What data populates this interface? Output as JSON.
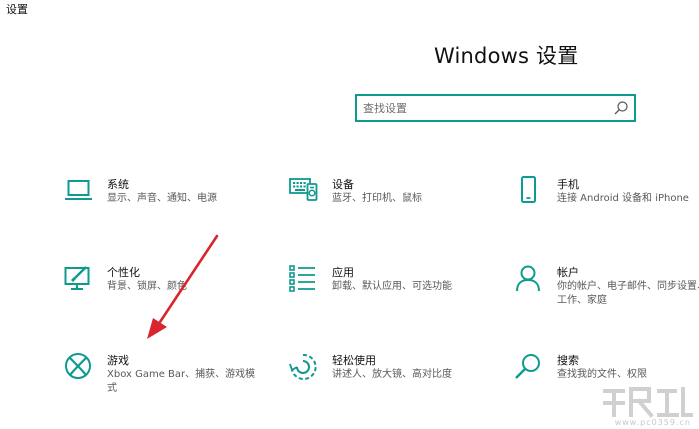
{
  "window": {
    "title": "设置"
  },
  "header": {
    "title": "Windows 设置"
  },
  "search": {
    "placeholder": "查找设置",
    "value": ""
  },
  "tiles": [
    {
      "name": "系统",
      "desc": "显示、声音、通知、电源",
      "icon": "laptop-icon"
    },
    {
      "name": "设备",
      "desc": "蓝牙、打印机、鼠标",
      "icon": "keyboard-icon"
    },
    {
      "name": "手机",
      "desc": "连接 Android 设备和 iPhone",
      "icon": "phone-icon"
    },
    {
      "name": "个性化",
      "desc": "背景、锁屏、颜色",
      "icon": "brush-icon"
    },
    {
      "name": "应用",
      "desc": "卸载、默认应用、可选功能",
      "icon": "apps-list-icon"
    },
    {
      "name": "帐户",
      "desc": "你的帐户、电子邮件、同步设置、工作、家庭",
      "icon": "person-icon"
    },
    {
      "name": "游戏",
      "desc": "Xbox Game Bar、捕获、游戏模式",
      "icon": "xbox-icon"
    },
    {
      "name": "轻松使用",
      "desc": "讲述人、放大镜、高对比度",
      "icon": "ease-of-access-icon"
    },
    {
      "name": "搜索",
      "desc": "查找我的文件、权限",
      "icon": "search-icon"
    }
  ],
  "annotation": {
    "color": "#d9262e"
  },
  "watermark": {
    "site": "www.pc0359.cn"
  },
  "colors": {
    "accent": "#0e9a8f",
    "text": "#111111",
    "secondary": "#595959"
  }
}
